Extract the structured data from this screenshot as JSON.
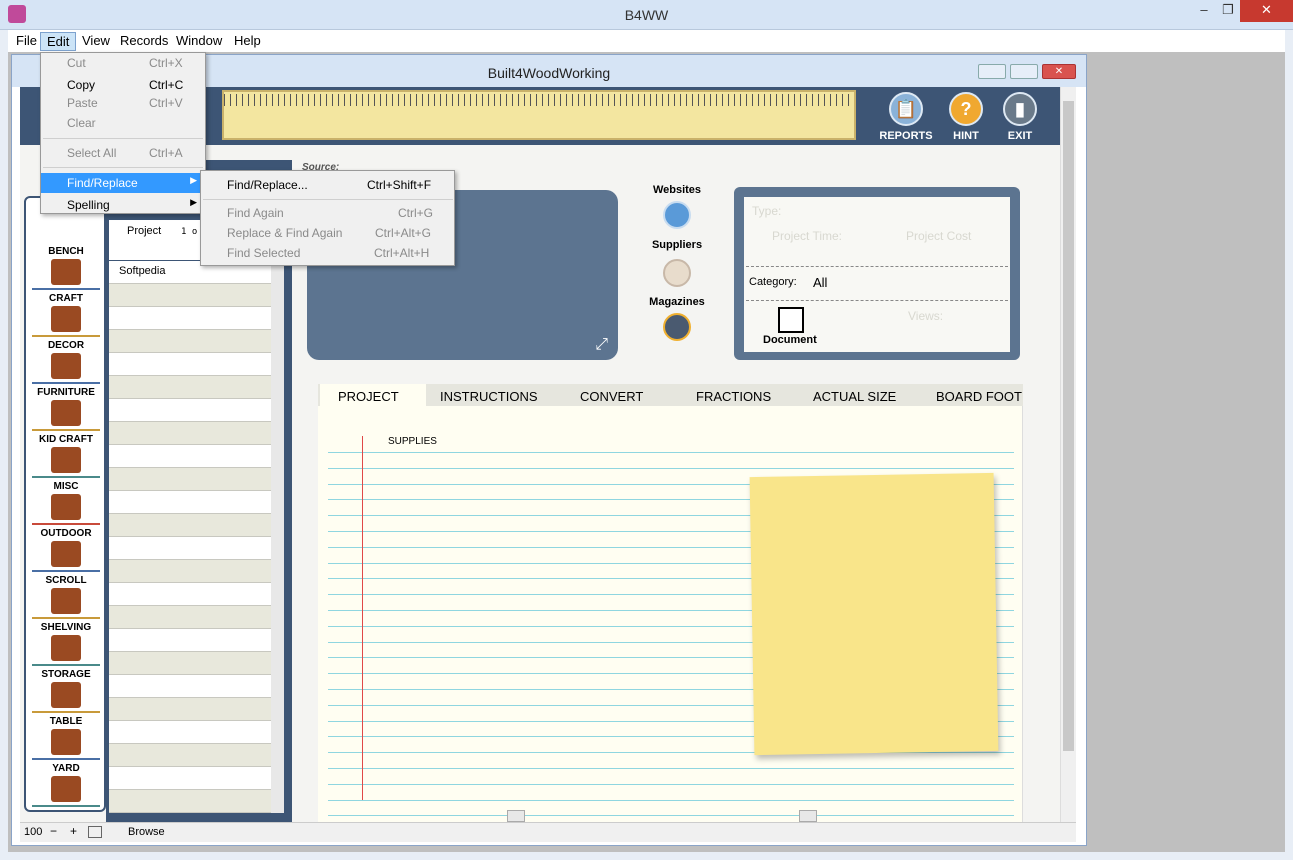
{
  "app_title": "B4WW",
  "inner_title": "Built4WoodWorking",
  "menubar": [
    "File",
    "Edit",
    "View",
    "Records",
    "Window",
    "Help"
  ],
  "edit_menu": {
    "items": [
      {
        "label": "Cut",
        "shortcut": "Ctrl+X",
        "disabled": true
      },
      {
        "label": "Copy",
        "shortcut": "Ctrl+C",
        "disabled": false
      },
      {
        "label": "Paste",
        "shortcut": "Ctrl+V",
        "disabled": true
      },
      {
        "label": "Clear",
        "shortcut": "",
        "disabled": true
      },
      {
        "label": "Select All",
        "shortcut": "Ctrl+A",
        "disabled": true
      },
      {
        "label": "Find/Replace",
        "shortcut": "",
        "disabled": false
      },
      {
        "label": "Spelling",
        "shortcut": "",
        "disabled": false
      }
    ]
  },
  "find_submenu": {
    "items": [
      {
        "label": "Find/Replace...",
        "shortcut": "Ctrl+Shift+F"
      },
      {
        "label": "Find Again",
        "shortcut": "Ctrl+G"
      },
      {
        "label": "Replace & Find Again",
        "shortcut": "Ctrl+Alt+G"
      },
      {
        "label": "Find Selected",
        "shortcut": "Ctrl+Alt+H"
      }
    ]
  },
  "toolbar": {
    "reports": "REPORTS",
    "hint": "HINT",
    "exit": "EXIT"
  },
  "categories": [
    "BENCH",
    "CRAFT",
    "DECOR",
    "FURNITURE",
    "KID CRAFT",
    "MISC",
    "OUTDOOR",
    "SCROLL",
    "SHELVING",
    "STORAGE",
    "TABLE",
    "YARD"
  ],
  "category_colors": [
    "#4a6fa5",
    "#c89a3a",
    "#4a6fa5",
    "#c89a3a",
    "#4a8a8a",
    "#c84a3a",
    "#4a6fa5",
    "#c89a3a",
    "#4a8a8a",
    "#c89a3a",
    "#4a6fa5",
    "#4a8a8a"
  ],
  "list": {
    "header": "Project",
    "count": "1 o",
    "first_row": "Softpedia"
  },
  "source_label": "Source:",
  "links": {
    "websites": "Websites",
    "suppliers": "Suppliers",
    "magazines": "Magazines"
  },
  "info": {
    "type": "Type:",
    "time": "Project Time:",
    "cost": "Project Cost",
    "category_label": "Category:",
    "category_value": "All",
    "document": "Document",
    "views": "Views:"
  },
  "tabs": [
    "PROJECT",
    "INSTRUCTIONS",
    "CONVERT",
    "FRACTIONS",
    "ACTUAL SIZE",
    "BOARD FOOT"
  ],
  "supplies_label": "SUPPLIES",
  "status": {
    "zoom": "100",
    "mode": "Browse"
  }
}
